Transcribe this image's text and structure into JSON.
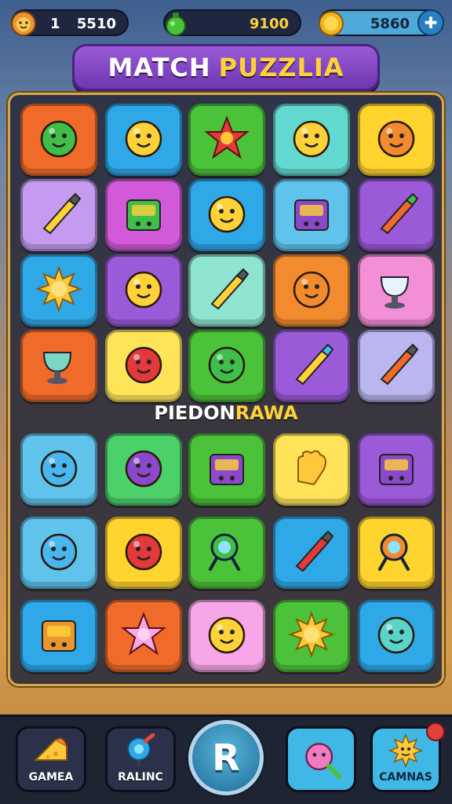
{
  "hud": {
    "lives": {
      "icon": "lion-face-icon",
      "tick": "1",
      "value": "5510"
    },
    "gems": {
      "icon": "green-potion-icon",
      "value": "9100"
    },
    "coins": {
      "icon": "gold-coin-icon",
      "value": "5860",
      "add_icon": "plus-icon"
    }
  },
  "title": {
    "part1": "MATCH",
    "part2": "PUZZLIA"
  },
  "subtitle": {
    "part1": "PIEDON",
    "part2": "RAWA"
  },
  "colors": {
    "accent": "#ffd23a",
    "banner": "#8b49c9",
    "board": "#282a3a",
    "frame": "#d9a64a"
  },
  "grid_top": [
    [
      {
        "color": "#f06a2a",
        "icon": "green-blob-icon"
      },
      {
        "color": "#2fa8e8",
        "icon": "yellow-bird-icon"
      },
      {
        "color": "#4cc23a",
        "icon": "red-star-icon"
      },
      {
        "color": "#63d8cf",
        "icon": "marshmallow-icon"
      },
      {
        "color": "#ffd42e",
        "icon": "orange-smiley-icon"
      }
    ],
    [
      {
        "color": "#c49bf0",
        "icon": "wrench-tool-icon"
      },
      {
        "color": "#d25ad8",
        "icon": "green-machine-icon"
      },
      {
        "color": "#2fa8e8",
        "icon": "yellow-drop-face-icon"
      },
      {
        "color": "#5fc3ec",
        "icon": "purple-box-icon"
      },
      {
        "color": "#9b5ad8",
        "icon": "carrot-icon"
      }
    ],
    [
      {
        "color": "#2fa8e8",
        "icon": "sun-icon"
      },
      {
        "color": "#9b5ad8",
        "icon": "yellow-bolt-icon"
      },
      {
        "color": "#8ee4d0",
        "icon": "pencil-square-icon"
      },
      {
        "color": "#f28a2e",
        "icon": "orange-bubble-icon"
      },
      {
        "color": "#f28fd6",
        "icon": "goblet-icon"
      }
    ],
    [
      {
        "color": "#f06a2a",
        "icon": "teacup-icon"
      },
      {
        "color": "#ffe45a",
        "icon": "red-bomb-icon"
      },
      {
        "color": "#4cc23a",
        "icon": "green-orb-icon"
      },
      {
        "color": "#9b5ad8",
        "icon": "arrow-pencil-icon"
      },
      {
        "color": "#b9b6f0",
        "icon": "rocket-icon"
      }
    ]
  ],
  "grid_bottom": [
    [
      {
        "color": "#5fc3ec",
        "icon": "blue-bubble-icon"
      },
      {
        "color": "#4cd06a",
        "icon": "purple-berry-icon"
      },
      {
        "color": "#4cc23a",
        "icon": "gift-box-icon"
      },
      {
        "color": "#ffe45a",
        "icon": "glove-icon"
      },
      {
        "color": "#9b5ad8",
        "icon": "dice-icon"
      }
    ],
    [
      {
        "color": "#5fc3ec",
        "icon": "blue-bird-icon"
      },
      {
        "color": "#ffd42e",
        "icon": "red-fish-icon"
      },
      {
        "color": "#4cc23a",
        "icon": "magnifier-icon"
      },
      {
        "color": "#2fa8e8",
        "icon": "crayon-icon"
      },
      {
        "color": "#ffd42e",
        "icon": "compass-icon"
      }
    ],
    [
      {
        "color": "#2fa8e8",
        "icon": "treasure-box-icon"
      },
      {
        "color": "#f06a2a",
        "icon": "pink-star-icon"
      },
      {
        "color": "#f7a6e8",
        "icon": "yellow-bubble-icon"
      },
      {
        "color": "#4cc23a",
        "icon": "sunburst-icon"
      },
      {
        "color": "#2fa8e8",
        "icon": "teal-bubble-icon"
      }
    ]
  ],
  "nav": {
    "items": [
      {
        "label": "GAMEA",
        "icon": "cheese-icon",
        "color": "#2a3148"
      },
      {
        "label": "RALINC",
        "icon": "lollipop-icon",
        "color": "#2a3148"
      },
      {
        "center_letter": "R",
        "icon": "play-orb-icon"
      },
      {
        "label": "",
        "icon": "pink-monster-icon",
        "color": "#3fb8e6"
      },
      {
        "label": "CAMNAS",
        "icon": "sun-face-icon",
        "color": "#3fb8e6"
      }
    ]
  }
}
